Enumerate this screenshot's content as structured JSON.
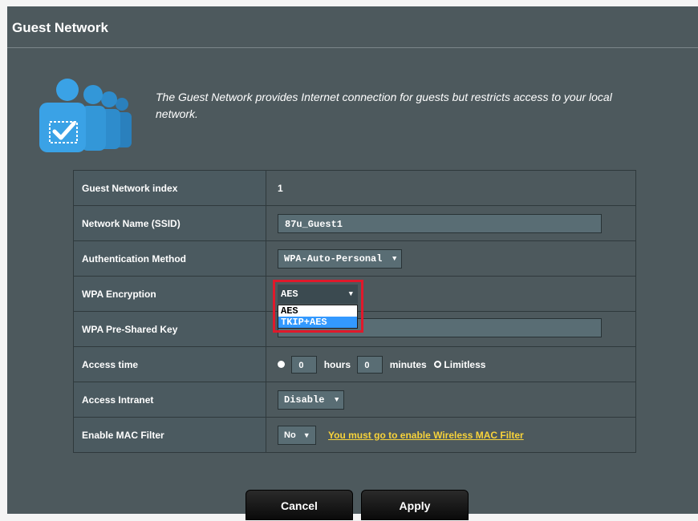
{
  "header": {
    "title": "Guest Network"
  },
  "intro": {
    "icon": "guest-users-icon",
    "text": "The Guest Network provides Internet connection for guests but restricts access to your local network."
  },
  "fields": {
    "index": {
      "label": "Guest Network index",
      "value": "1"
    },
    "ssid": {
      "label": "Network Name (SSID)",
      "value": "87u_Guest1"
    },
    "auth": {
      "label": "Authentication Method",
      "value": "WPA-Auto-Personal"
    },
    "encryption": {
      "label": "WPA Encryption",
      "value": "AES",
      "options": [
        "AES",
        "TKIP+AES"
      ],
      "highlighted_option": "TKIP+AES"
    },
    "psk": {
      "label": "WPA Pre-Shared Key",
      "value": ""
    },
    "access_time": {
      "label": "Access time",
      "hours_value": "0",
      "hours_label": "hours",
      "minutes_value": "0",
      "minutes_label": "minutes",
      "limitless_label": "Limitless",
      "selected": "Limitless"
    },
    "intranet": {
      "label": "Access Intranet",
      "value": "Disable"
    },
    "mac_filter": {
      "label": "Enable MAC Filter",
      "value": "No",
      "link_text": "You must go to enable Wireless MAC Filter"
    }
  },
  "buttons": {
    "cancel": "Cancel",
    "apply": "Apply"
  },
  "colors": {
    "panel": "#4d595d",
    "label_cell": "#4b5a60",
    "highlight": "#e0192b",
    "link": "#f8d33a",
    "icon": "#2e90d1"
  }
}
